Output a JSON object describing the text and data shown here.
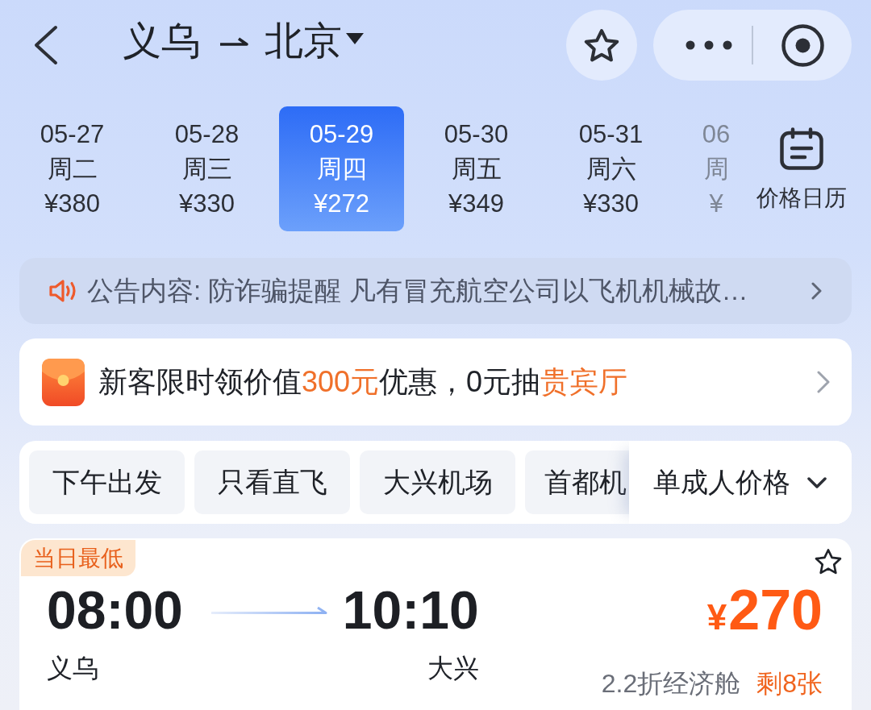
{
  "header": {
    "origin": "义乌",
    "destination": "北京"
  },
  "dates": [
    {
      "date": "05-27",
      "weekday": "周二",
      "price": "¥380",
      "selected": false
    },
    {
      "date": "05-28",
      "weekday": "周三",
      "price": "¥330",
      "selected": false
    },
    {
      "date": "05-29",
      "weekday": "周四",
      "price": "¥272",
      "selected": true
    },
    {
      "date": "05-30",
      "weekday": "周五",
      "price": "¥349",
      "selected": false
    },
    {
      "date": "05-31",
      "weekday": "周六",
      "price": "¥330",
      "selected": false
    },
    {
      "date": "06",
      "weekday": "周",
      "price": "¥",
      "selected": false
    }
  ],
  "calendar_button": {
    "label": "价格日历"
  },
  "notice": {
    "text": "公告内容: 防诈骗提醒 凡有冒充航空公司以飞机机械故…"
  },
  "promo": {
    "segments": [
      {
        "text": "新客限时领价值",
        "highlight": false
      },
      {
        "text": "300元",
        "highlight": true
      },
      {
        "text": "优惠，0元抽",
        "highlight": false
      },
      {
        "text": "贵宾厅",
        "highlight": true
      }
    ]
  },
  "filters": {
    "chips": [
      {
        "label": "下午出发",
        "selected": false
      },
      {
        "label": "只看直飞",
        "selected": false
      },
      {
        "label": "大兴机场",
        "selected": false
      },
      {
        "label": "首都机",
        "selected": false
      }
    ],
    "passenger_price": {
      "label": "单成人价格"
    }
  },
  "flights": [
    {
      "badge": "当日最低",
      "depart_time": "08:00",
      "arrive_time": "10:10",
      "depart_airport": "义乌",
      "arrive_airport": "大兴",
      "currency": "¥",
      "price": "270",
      "cabin": "2.2折经济舱",
      "remaining": "剩8张"
    }
  ]
}
